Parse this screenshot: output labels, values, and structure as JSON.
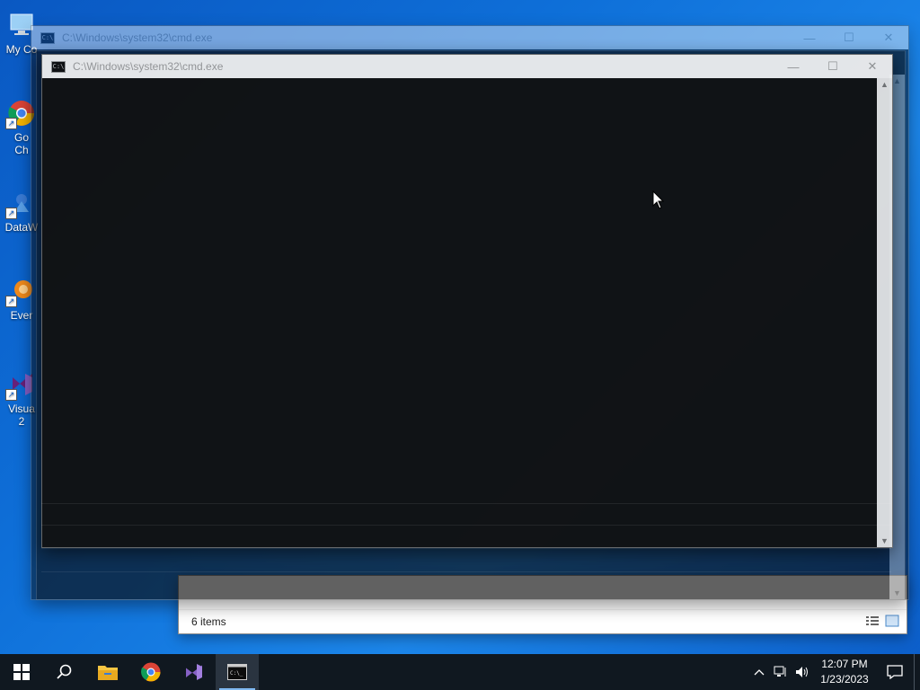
{
  "desktop": {
    "icons": [
      {
        "label": "My Co",
        "icon": "computer-icon"
      },
      {
        "label": "Go",
        "label2": "Ch",
        "icon": "chrome-icon"
      },
      {
        "label": "DataW",
        "icon": "datawarehouse-icon"
      },
      {
        "label": "Ever",
        "icon": "everything-icon"
      },
      {
        "label": "Visua",
        "label2": "2",
        "icon": "visual-studio-icon"
      }
    ]
  },
  "windows": {
    "cmd_back": {
      "title": "C:\\Windows\\system32\\cmd.exe"
    },
    "cmd_front": {
      "title": "C:\\Windows\\system32\\cmd.exe"
    },
    "explorer": {
      "status_items": "6 items"
    }
  },
  "taskbar": {
    "apps": [
      "start",
      "search",
      "file-explorer",
      "chrome",
      "visual-studio",
      "cmd"
    ],
    "active_app": "cmd",
    "clock": {
      "time": "12:07 PM",
      "date": "1/23/2023"
    },
    "colors": {
      "taskbar_bg": "#101820",
      "active_indicator": "#7fb8f0"
    }
  }
}
